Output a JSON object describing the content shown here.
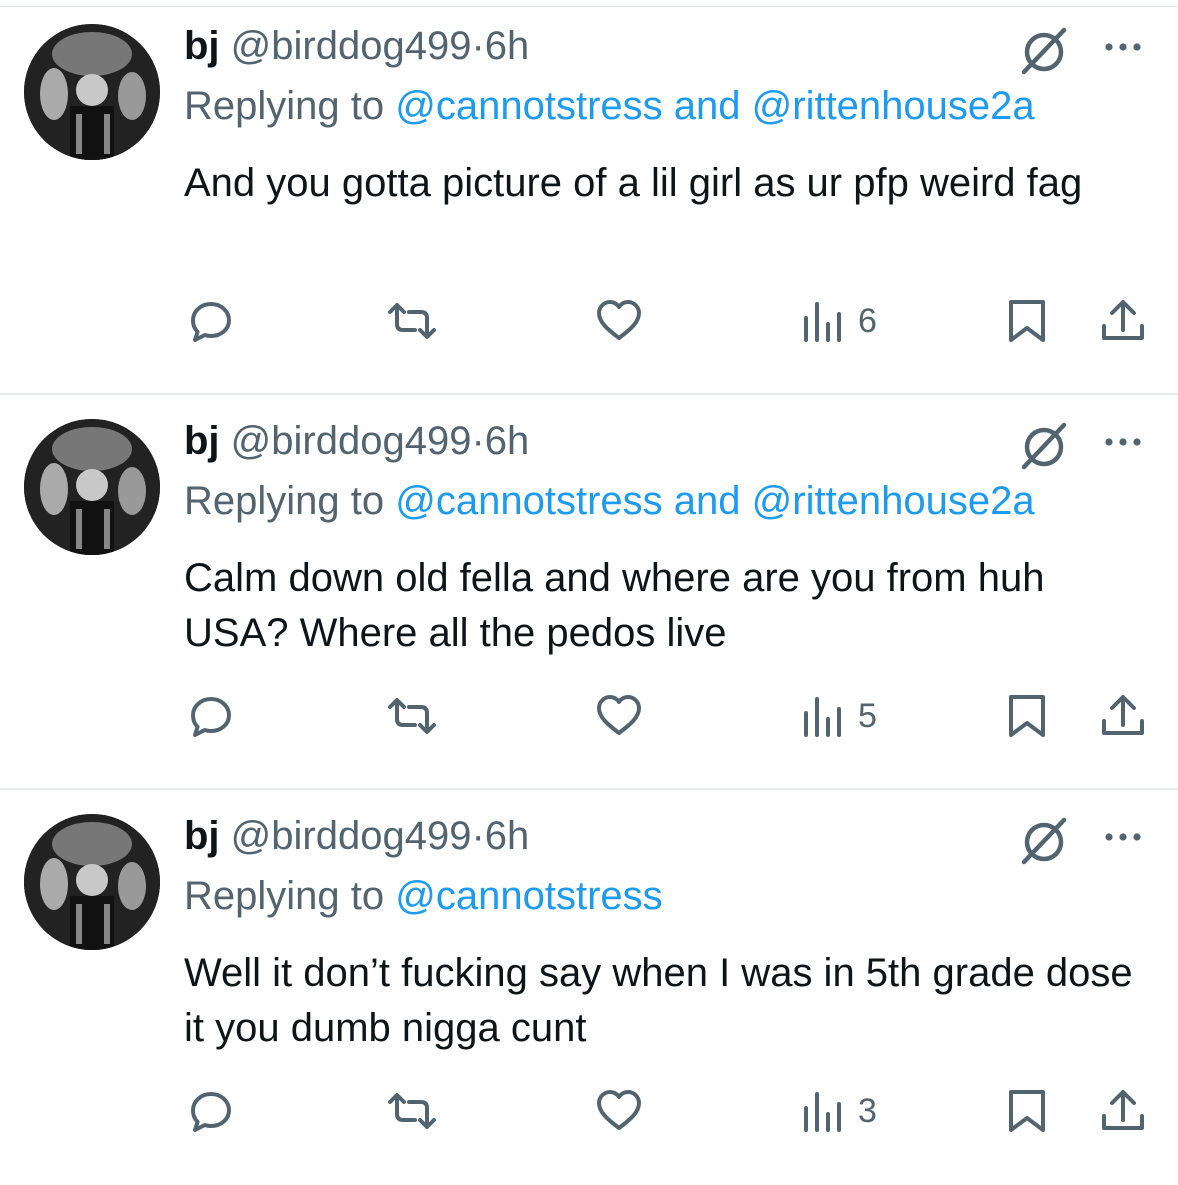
{
  "tweets": [
    {
      "name": "bj",
      "handle": "@birddog499",
      "dot": "·",
      "time": "6h",
      "replying_prefix": "Replying to",
      "mention1": "@cannotstress",
      "and": "and",
      "mention2": "@rittenhouse2a",
      "text": "And you gotta picture of a lil girl as ur pfp weird fag",
      "views": "6"
    },
    {
      "name": "bj",
      "handle": "@birddog499",
      "dot": "·",
      "time": "6h",
      "replying_prefix": "Replying to",
      "mention1": "@cannotstress",
      "and": "and",
      "mention2": "@rittenhouse2a",
      "text": "Calm down old fella and where are you from huh USA? Where all the pedos live",
      "views": "5"
    },
    {
      "name": "bj",
      "handle": "@birddog499",
      "dot": "·",
      "time": "6h",
      "replying_prefix": "Replying to",
      "mention1": "@cannotstress",
      "text": "Well it don’t fucking say when I was in 5th grade dose it you dumb nigga cunt",
      "views": "3"
    }
  ],
  "icons": [
    "grok-icon",
    "more-icon",
    "reply-icon",
    "retweet-icon",
    "like-icon",
    "views-icon",
    "bookmark-icon",
    "share-icon"
  ],
  "colors": {
    "link": "#1d9bf0",
    "secondary": "#536471",
    "text": "#0f1419"
  }
}
